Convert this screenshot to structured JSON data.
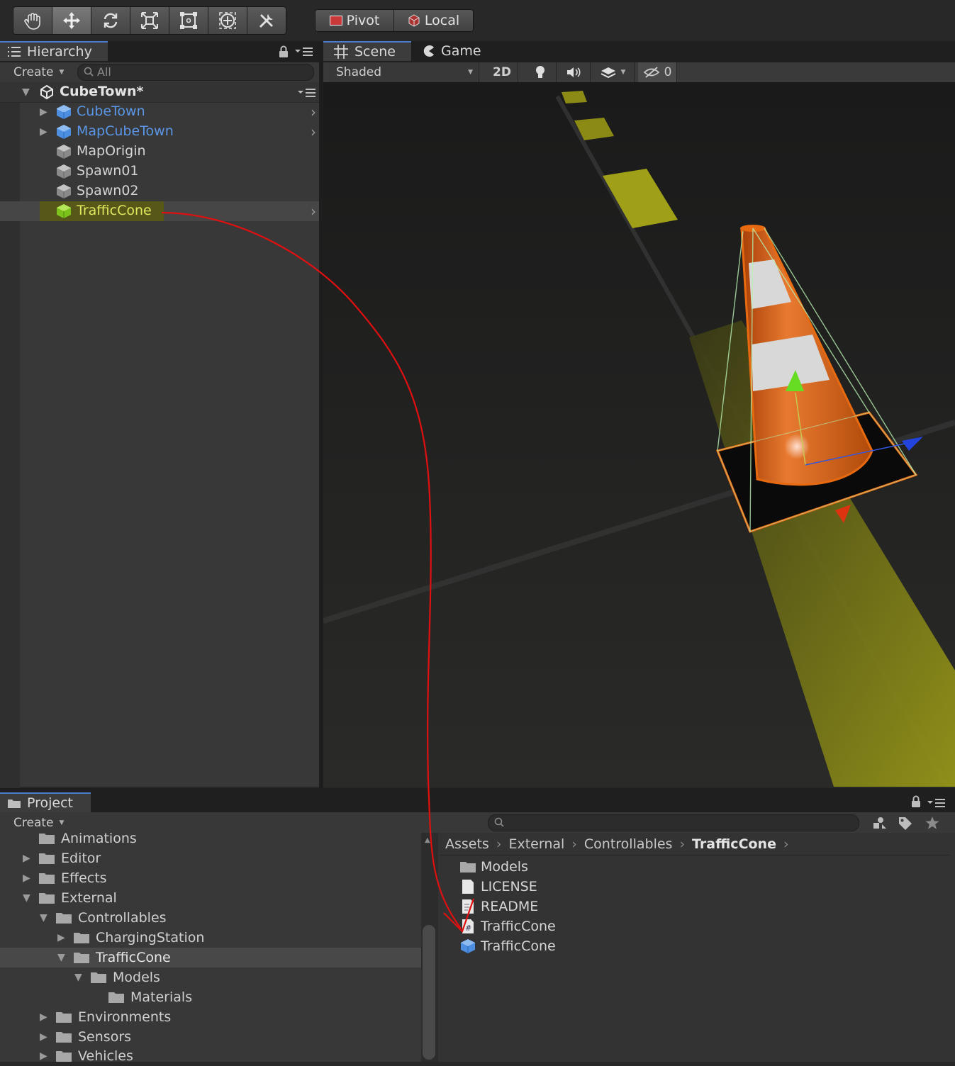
{
  "toolbar": {
    "tools": [
      "hand-tool",
      "move-tool",
      "rotate-tool",
      "scale-tool",
      "rect-tool",
      "transform-tool",
      "custom-tool"
    ],
    "active_tool": "move-tool",
    "pivot_label": "Pivot",
    "local_label": "Local"
  },
  "hierarchy": {
    "tab_label": "Hierarchy",
    "create_label": "Create",
    "search_placeholder": "All",
    "scene_name": "CubeTown*",
    "items": [
      {
        "label": "CubeTown",
        "type": "prefab",
        "expandable": true
      },
      {
        "label": "MapCubeTown",
        "type": "prefab",
        "expandable": true
      },
      {
        "label": "MapOrigin",
        "type": "object",
        "expandable": false
      },
      {
        "label": "Spawn01",
        "type": "object",
        "expandable": false
      },
      {
        "label": "Spawn02",
        "type": "object",
        "expandable": false
      },
      {
        "label": "TrafficCone",
        "type": "selected",
        "expandable": true
      }
    ]
  },
  "scene": {
    "tab_scene": "Scene",
    "tab_game": "Game",
    "shading_mode": "Shaded",
    "mode_2d": "2D",
    "hidden_count": "0"
  },
  "project": {
    "tab_label": "Project",
    "create_label": "Create",
    "tree": [
      {
        "label": "Animations",
        "depth": 2,
        "expand": "none"
      },
      {
        "label": "Editor",
        "depth": 1,
        "expand": "collapsed"
      },
      {
        "label": "Effects",
        "depth": 1,
        "expand": "collapsed"
      },
      {
        "label": "External",
        "depth": 1,
        "expand": "expanded"
      },
      {
        "label": "Controllables",
        "depth": 2,
        "expand": "expanded"
      },
      {
        "label": "ChargingStation",
        "depth": 3,
        "expand": "collapsed"
      },
      {
        "label": "TrafficCone",
        "depth": 3,
        "expand": "expanded",
        "selected": true
      },
      {
        "label": "Models",
        "depth": 4,
        "expand": "expanded"
      },
      {
        "label": "Materials",
        "depth": 5,
        "expand": "none"
      },
      {
        "label": "Environments",
        "depth": 2,
        "expand": "collapsed"
      },
      {
        "label": "Sensors",
        "depth": 2,
        "expand": "collapsed"
      },
      {
        "label": "Vehicles",
        "depth": 2,
        "expand": "collapsed"
      }
    ],
    "breadcrumb": [
      "Assets",
      "External",
      "Controllables",
      "TrafficCone"
    ],
    "files": [
      {
        "label": "Models",
        "kind": "folder-icon"
      },
      {
        "label": "LICENSE",
        "kind": "text-file-icon"
      },
      {
        "label": "README",
        "kind": "text-file-icon"
      },
      {
        "label": "TrafficCone",
        "kind": "script-file-icon"
      },
      {
        "label": "TrafficCone",
        "kind": "prefab-icon"
      }
    ]
  },
  "colors": {
    "accent_blue": "#4a7dcc",
    "prefab_blue": "#5a96e6",
    "selection_yellow": "#e0e860",
    "annotation_red": "#e01010",
    "cone_orange": "#e86a10"
  }
}
